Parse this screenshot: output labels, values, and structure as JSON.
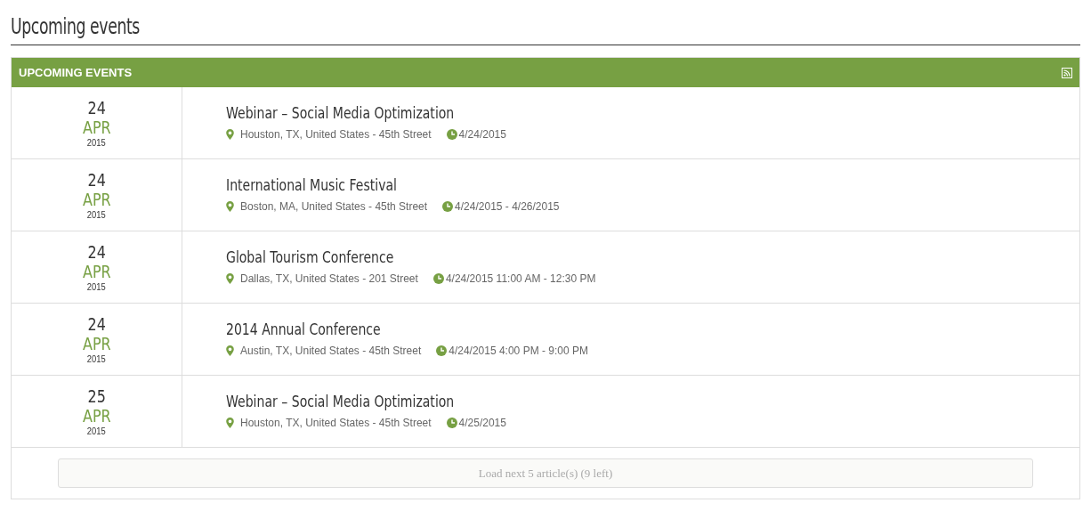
{
  "page_title": "Upcoming events",
  "panel": {
    "title": "UPCOMING EVENTS"
  },
  "events": [
    {
      "day": "24",
      "month": "APR",
      "year": "2015",
      "title": "Webinar – Social Media Optimization",
      "location": "Houston, TX, United States - 45th Street",
      "time": "4/24/2015"
    },
    {
      "day": "24",
      "month": "APR",
      "year": "2015",
      "title": "International Music Festival",
      "location": "Boston, MA, United States - 45th Street",
      "time": "4/24/2015 - 4/26/2015"
    },
    {
      "day": "24",
      "month": "APR",
      "year": "2015",
      "title": "Global Tourism Conference",
      "location": "Dallas, TX, United States - 201 Street",
      "time": "4/24/2015 11:00 AM - 12:30 PM"
    },
    {
      "day": "24",
      "month": "APR",
      "year": "2015",
      "title": "2014 Annual Conference",
      "location": "Austin, TX, United States - 45th Street",
      "time": "4/24/2015 4:00 PM - 9:00 PM"
    },
    {
      "day": "25",
      "month": "APR",
      "year": "2015",
      "title": "Webinar – Social Media Optimization",
      "location": "Houston, TX, United States - 45th Street",
      "time": "4/25/2015"
    }
  ],
  "load_more": {
    "label": "Load next 5 article(s) (9 left)"
  }
}
